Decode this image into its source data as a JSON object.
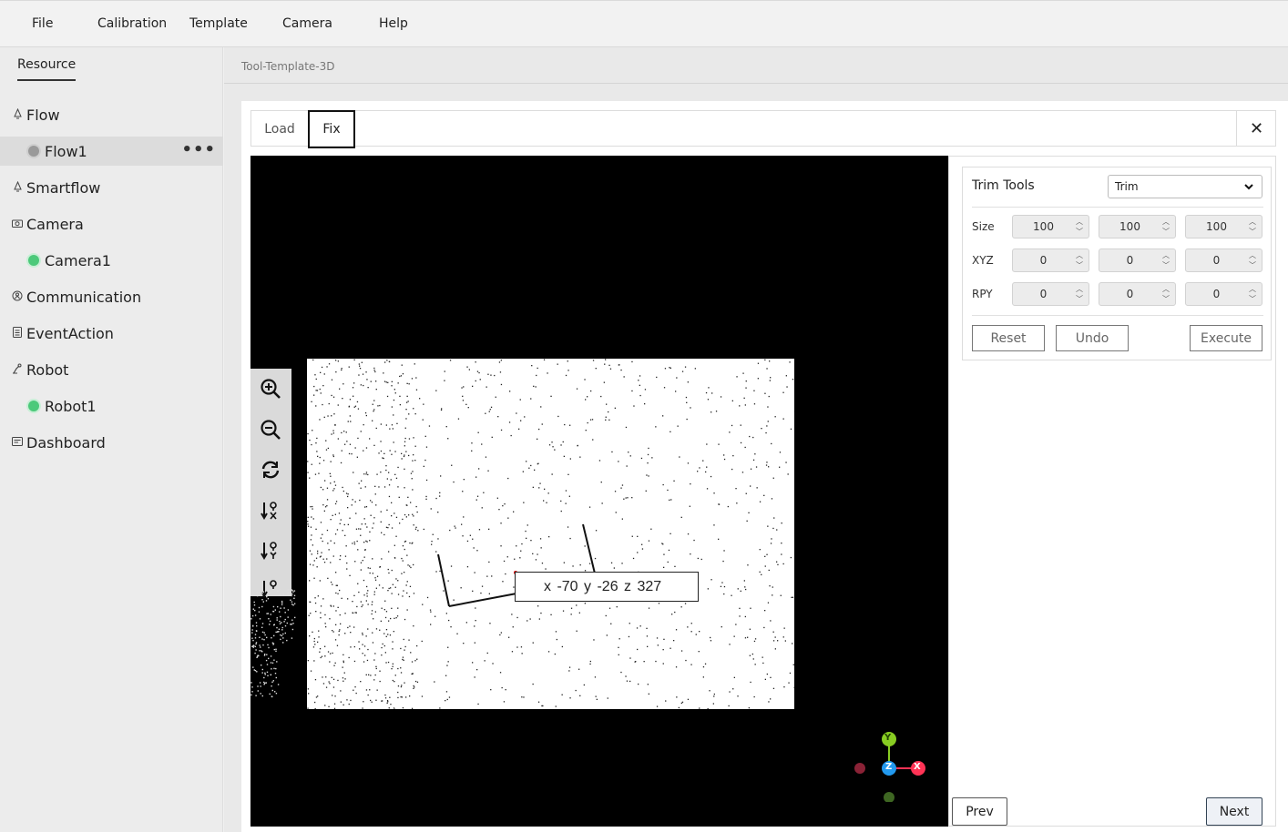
{
  "menu": [
    "File",
    "Calibration",
    "Template",
    "Camera",
    "Help"
  ],
  "sidebar": {
    "tab": "Resource",
    "items": [
      {
        "label": "Flow",
        "icon": "bell-icon"
      },
      {
        "label": "Flow1",
        "status": "gray"
      },
      {
        "label": "Smartflow",
        "icon": "bell-icon"
      },
      {
        "label": "Camera",
        "icon": "camera-icon"
      },
      {
        "label": "Camera1",
        "status": "green"
      },
      {
        "label": "Communication",
        "icon": "network-icon"
      },
      {
        "label": "EventAction",
        "icon": "list-icon"
      },
      {
        "label": "Robot",
        "icon": "robot-icon"
      },
      {
        "label": "Robot1",
        "status": "green"
      },
      {
        "label": "Dashboard",
        "icon": "dashboard-icon"
      }
    ],
    "more": "•••"
  },
  "breadcrumb": "Tool-Template-3D",
  "tabs": {
    "load": "Load",
    "fix": "Fix",
    "close": "✕"
  },
  "viewer": {
    "coords": "x -70   y -26   z 327",
    "axes": {
      "x": "X",
      "y": "Y",
      "z": "Z"
    },
    "axis_colors": {
      "x": "#ff3355",
      "y": "#88cc22",
      "z": "#2299ee"
    }
  },
  "trim": {
    "title": "Trim Tools",
    "mode": "Trim",
    "rows": [
      {
        "label": "Size",
        "values": [
          "100",
          "100",
          "100"
        ]
      },
      {
        "label": "XYZ",
        "values": [
          "0",
          "0",
          "0"
        ]
      },
      {
        "label": "RPY",
        "values": [
          "0",
          "0",
          "0"
        ]
      }
    ],
    "reset": "Reset",
    "undo": "Undo",
    "execute": "Execute"
  },
  "nav": {
    "prev": "Prev",
    "next": "Next"
  }
}
